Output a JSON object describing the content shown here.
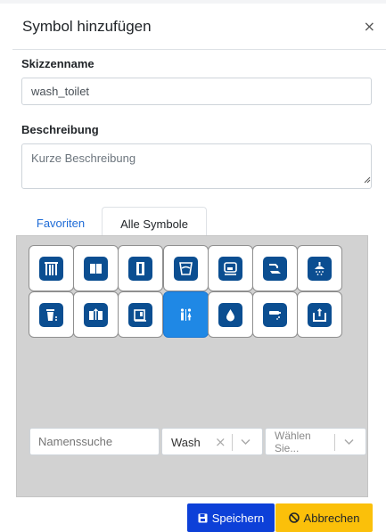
{
  "dialog": {
    "title": "Symbol hinzufügen",
    "close_glyph": "×"
  },
  "form": {
    "name_label": "Skizzenname",
    "name_value": "wash_toilet",
    "description_label": "Beschreibung",
    "description_placeholder": "Kurze Beschreibung"
  },
  "tabs": {
    "favorites": "Favoriten",
    "all_symbols": "Alle Symbole",
    "active": "all_symbols"
  },
  "symbols": {
    "selected_index": 10,
    "items": [
      {
        "icon": "urinal-partition-icon"
      },
      {
        "icon": "locker-icon"
      },
      {
        "icon": "door-icon"
      },
      {
        "icon": "glass-icon"
      },
      {
        "icon": "hand-dryer-icon"
      },
      {
        "icon": "faucet-hand-icon"
      },
      {
        "icon": "shower-icon"
      },
      {
        "icon": "trash-bin-icon"
      },
      {
        "icon": "double-door-arrow-icon"
      },
      {
        "icon": "dispenser-icon"
      },
      {
        "icon": "restroom-icon"
      },
      {
        "icon": "water-drop-icon"
      },
      {
        "icon": "soap-dispenser-icon"
      },
      {
        "icon": "sink-tap-icon"
      }
    ]
  },
  "filters": {
    "name_search_placeholder": "Namenssuche",
    "category_value": "Wash",
    "clear_glyph": "×",
    "third_placeholder": "Wählen Sie..."
  },
  "footer": {
    "save_label": "Speichern",
    "cancel_label": "Abbrechen"
  },
  "colors": {
    "accent_blue": "#0d40d8",
    "cancel_yellow": "#fbc00a",
    "tab_link": "#1e6bd6",
    "symbol_icon": "#0b4e91",
    "selected_tile": "#1f88e5"
  }
}
